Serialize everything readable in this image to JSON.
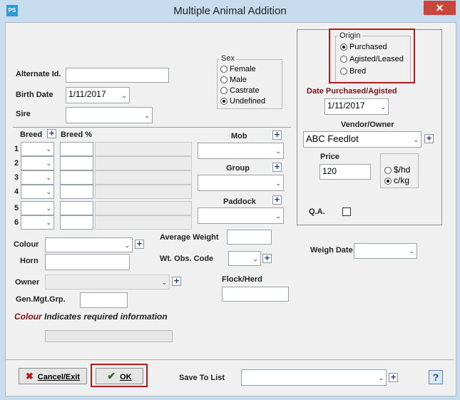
{
  "window": {
    "title": "Multiple Animal Addition",
    "app_icon": "PS",
    "close": "✕"
  },
  "labels": {
    "alternate_id": "Alternate Id.",
    "birth_date": "Birth Date",
    "sire": "Sire",
    "breed": "Breed",
    "breed_pct": "Breed %",
    "mob": "Mob",
    "group": "Group",
    "paddock": "Paddock",
    "colour": "Colour",
    "horn": "Horn",
    "owner": "Owner",
    "gen_mgt_grp": "Gen.Mgt.Grp.",
    "average_weight": "Average Weight",
    "wt_obs_code": "Wt. Obs. Code",
    "flock_herd": "Flock/Herd",
    "weigh_date": "Weigh Date",
    "required_word": "Colour",
    "required_text": " Indicates required information"
  },
  "fields": {
    "birth_date": "1/11/2017",
    "date_purchased": "1/11/2017",
    "vendor": "ABC Feedlot",
    "price": "120"
  },
  "breed_rows": [
    "1",
    "2",
    "3",
    "4",
    "5",
    "6"
  ],
  "sex": {
    "title": "Sex",
    "options": [
      "Female",
      "Male",
      "Castrate",
      "Undefined"
    ],
    "selected": "Undefined"
  },
  "origin": {
    "title": "Origin",
    "options": [
      "Purchased",
      "Agisted/Leased",
      "Bred"
    ],
    "selected": "Purchased"
  },
  "purchase": {
    "date_label": "Date Purchased/Agisted",
    "vendor_label": "Vendor/Owner",
    "price_label": "Price",
    "units": [
      "$/hd",
      "c/kg"
    ],
    "unit_selected": "c/kg",
    "qa_label": "Q.A."
  },
  "buttons": {
    "cancel": "Cancel/Exit",
    "ok": "OK",
    "save_to_list": "Save To List",
    "help": "?"
  },
  "colors": {
    "required": "#7b1515",
    "highlight": "#b01c1c",
    "title_bg": "#c7dcef"
  }
}
